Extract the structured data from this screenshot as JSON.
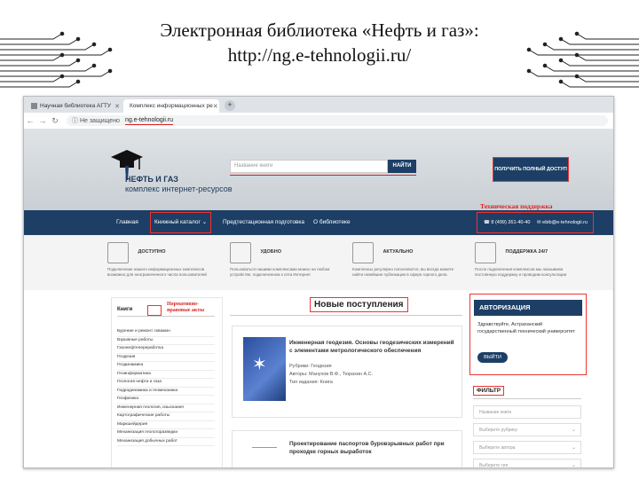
{
  "slide": {
    "title_line1": "Электронная библиотека «Нефть и газ»:",
    "title_line2": "http://ng.e-tehnologii.ru/"
  },
  "browser": {
    "tabs": [
      {
        "label": "Научная библиотека АГТУ",
        "active": false
      },
      {
        "label": "Комплекс информационных ре",
        "active": true
      }
    ],
    "new_tab": "+",
    "security": "Не защищено",
    "url": "ng.e-tehnologii.ru"
  },
  "site": {
    "logo_name": "НЕФТЬ И ГАЗ",
    "logo_sub": "комплекс интернет-ресурсов",
    "search_placeholder": "Название книги",
    "search_button": "НАЙТИ",
    "access_button": "ПОЛУЧИТЬ ПОЛНЫЙ ДОСТУП",
    "support_annotation": "Техническая поддержка",
    "menu": [
      "Главная",
      "Книжный каталог",
      "Предтестационная подготовка",
      "О библиотеке"
    ],
    "phone": "8 (499) 261-40-40",
    "email": "ebib@e-tehnologii.ru",
    "features": [
      {
        "title": "ДОСТУПНО",
        "text": "Подключение нашего информационных комплексов возможно для неограниченного числа пользователей"
      },
      {
        "title": "УДОБНО",
        "text": "Пользоваться нашими комплексами можно на любом устройстве, подключенном к сети Интернет"
      },
      {
        "title": "АКТУАЛЬНО",
        "text": "Комплексы регулярно пополняются, вы всегда можете найти новейшие публикации в сфере горного дела"
      },
      {
        "title": "ПОДДЕРЖКА 24/7",
        "text": "После подключения комплексов мы оказываем постоянную поддержку и проводим консультации"
      }
    ],
    "sidebar": {
      "heading": "Книги",
      "annotation": "Нормативно-правовые акты",
      "items": [
        "Бурение и ремонт скважин",
        "Взрывные работы",
        "Газонефтепереработка",
        "Геодезия",
        "Геодинамика",
        "Геоинформатика",
        "Геология нефти и газа",
        "Гидродинамика и геомеханика",
        "Геофизика",
        "Инженерная геология, изыскания",
        "Картографические работы",
        "Маркшейдерия",
        "Механизация геологоразведки",
        "Механизация добычных работ"
      ]
    },
    "new_arrivals_title": "Новые поступления",
    "books": [
      {
        "title": "Инженерная геодезия. Основы геодезических измерений с элементами метрологического обеспечения",
        "rubric": "Рубрики: Геодезия",
        "authors": "Авторы: Манухов В.Ф., Тюрахин А.С.",
        "type": "Тип издания: Книга"
      },
      {
        "title": "Проектирование паспортов буровзрывных работ при проходке горных выработок"
      }
    ],
    "auth": {
      "heading": "АВТОРИЗАЦИЯ",
      "text": "Здравствуйте, Астраханский государственный технический университет",
      "button": "ВЫЙТИ"
    },
    "filter": {
      "label": "ФИЛЬТР",
      "fields": [
        "Название книги",
        "Выберите рубрику",
        "Выберите автора",
        "Выберите тип"
      ]
    }
  },
  "colors": {
    "navy": "#1d3f66",
    "annotation_red": "#d22"
  }
}
